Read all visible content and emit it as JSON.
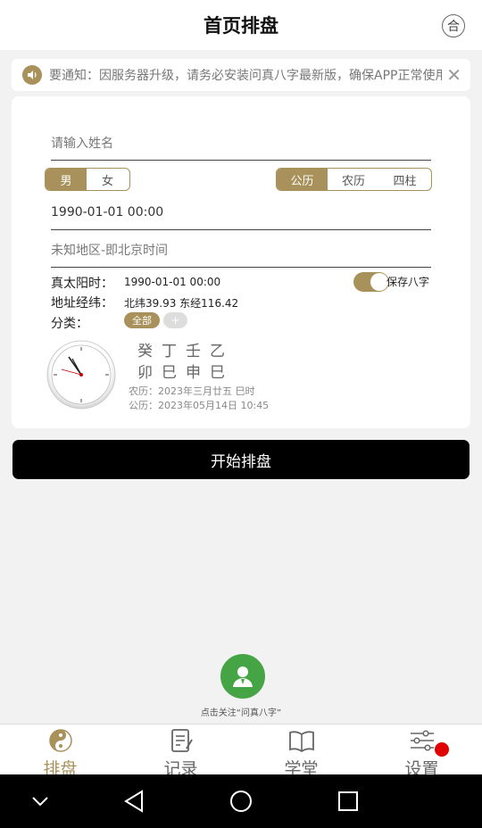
{
  "header": {
    "title": "首页排盘",
    "right_btn": "合"
  },
  "notice": {
    "text": "要通知：因服务器升级，请务必安装问真八字最新版，确保APP正常使用",
    "close": "✕"
  },
  "form": {
    "name_placeholder": "请输入姓名",
    "gender": {
      "male": "男",
      "female": "女",
      "selected": "男"
    },
    "calendar": {
      "options": [
        "公历",
        "农历",
        "四柱"
      ],
      "selected": "公历"
    },
    "datetime": "1990-01-01 00:00",
    "region_placeholder": "未知地区-即北京时间",
    "solar_time_label": "真太阳时：",
    "solar_time_value": "1990-01-01 00:00",
    "save_bazi_label": "保存八字",
    "save_bazi_on": true,
    "address_label": "地址经纬：",
    "address_value": "北纬39.93 东经116.42",
    "category_label": "分类：",
    "category_all": "全部",
    "category_add": "+"
  },
  "bazi": {
    "stems": [
      "癸",
      "丁",
      "壬",
      "乙"
    ],
    "branches": [
      "卯",
      "巳",
      "申",
      "巳"
    ],
    "lunar": "农历：2023年三月廿五 巳时",
    "solar": "公历：2023年05月14日 10:45"
  },
  "start_button": "开始排盘",
  "follow_text": "点击关注“问真八字”",
  "tabs": [
    {
      "label": "排盘",
      "icon": "yin-yang-icon",
      "active": true
    },
    {
      "label": "记录",
      "icon": "notes-icon",
      "active": false
    },
    {
      "label": "学堂",
      "icon": "book-icon",
      "active": false
    },
    {
      "label": "设置",
      "icon": "sliders-icon",
      "active": false
    }
  ],
  "colors": {
    "accent": "#a8915a",
    "follow_green": "#45a444",
    "badge_red": "#e00000"
  }
}
